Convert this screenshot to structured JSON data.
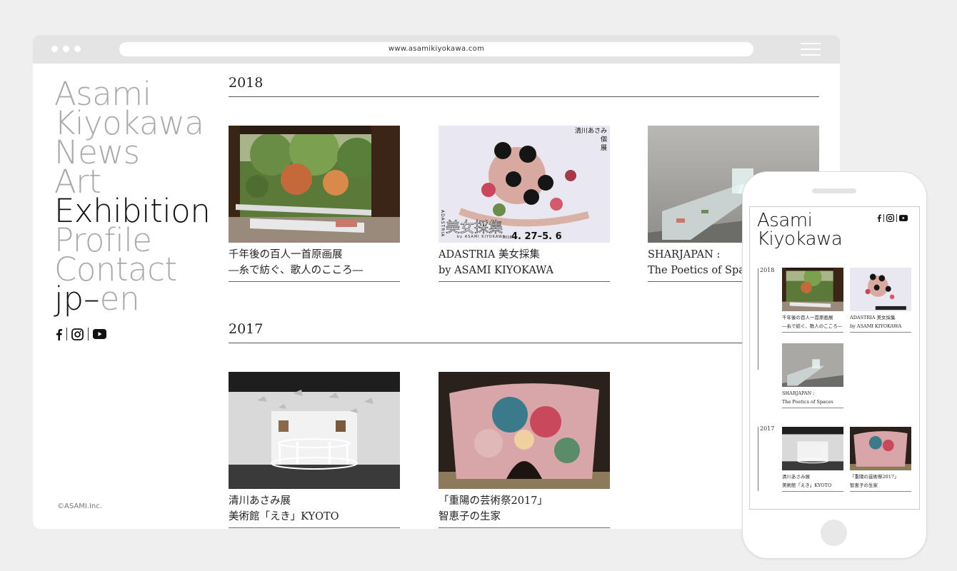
{
  "browser": {
    "url": "www.asamikiyokawa.com"
  },
  "site": {
    "title_line1": "Asami",
    "title_line2": "Kiyokawa",
    "nav": [
      {
        "label": "News"
      },
      {
        "label": "Art"
      },
      {
        "label": "Exhibition",
        "active": true
      },
      {
        "label": "Profile"
      },
      {
        "label": "Contact"
      }
    ],
    "lang": {
      "jp": "jp",
      "dash": "–",
      "en": "en"
    },
    "social": [
      "facebook-icon",
      "instagram-icon",
      "youtube-icon"
    ],
    "copyright": "©ASAMI.Inc."
  },
  "exhibitions": {
    "y2018": {
      "year": "2018",
      "items": [
        {
          "line1": "千年後の百人一首原画展",
          "line2": "―糸で紡ぐ、歌人のこころ―"
        },
        {
          "line1": "ADASTRIA 美女採集",
          "line2": "by ASAMI KIYOKAWA",
          "poster": {
            "artist": "清川あさみ",
            "kind1": "個",
            "kind2": "展",
            "title": "美女採集",
            "brand": "ADASTRIA",
            "by": "by ASAMI KIYOKAWA",
            "year": "2018",
            "dates": "4. 27–5. 6"
          }
        },
        {
          "line1": "SHARJAPAN :",
          "line2": "The Poetics of Spaces"
        }
      ]
    },
    "y2017": {
      "year": "2017",
      "items": [
        {
          "line1": "清川あさみ展",
          "line2": "美術館「えき」KYOTO"
        },
        {
          "line1": "「重陽の芸術祭2017」",
          "line2": "智恵子の生家"
        }
      ]
    }
  },
  "mobile": {
    "title_line1": "Asami",
    "title_line2": "Kiyokawa",
    "y2018": {
      "year": "2018",
      "items": [
        {
          "line1": "千年後の百人一首原画展",
          "line2": "―糸で紡ぐ、歌人のこころ―"
        },
        {
          "line1": "ADASTRIA 美女採集",
          "line2": "by ASAMI KIYOKAWA"
        },
        {
          "line1": "SHARJAPAN :",
          "line2": "The Poetics of Spaces"
        }
      ]
    },
    "y2017": {
      "year": "2017",
      "items": [
        {
          "line1": "清川あさみ展",
          "line2": "美術館「えき」KYOTO"
        },
        {
          "line1": "「重陽の芸術祭2017」",
          "line2": "智恵子の生家"
        }
      ]
    }
  },
  "colors": {
    "background": "#efefef",
    "nav_inactive": "#aaaaaa",
    "nav_active": "#111111",
    "chrome": "#e4e4e4"
  }
}
